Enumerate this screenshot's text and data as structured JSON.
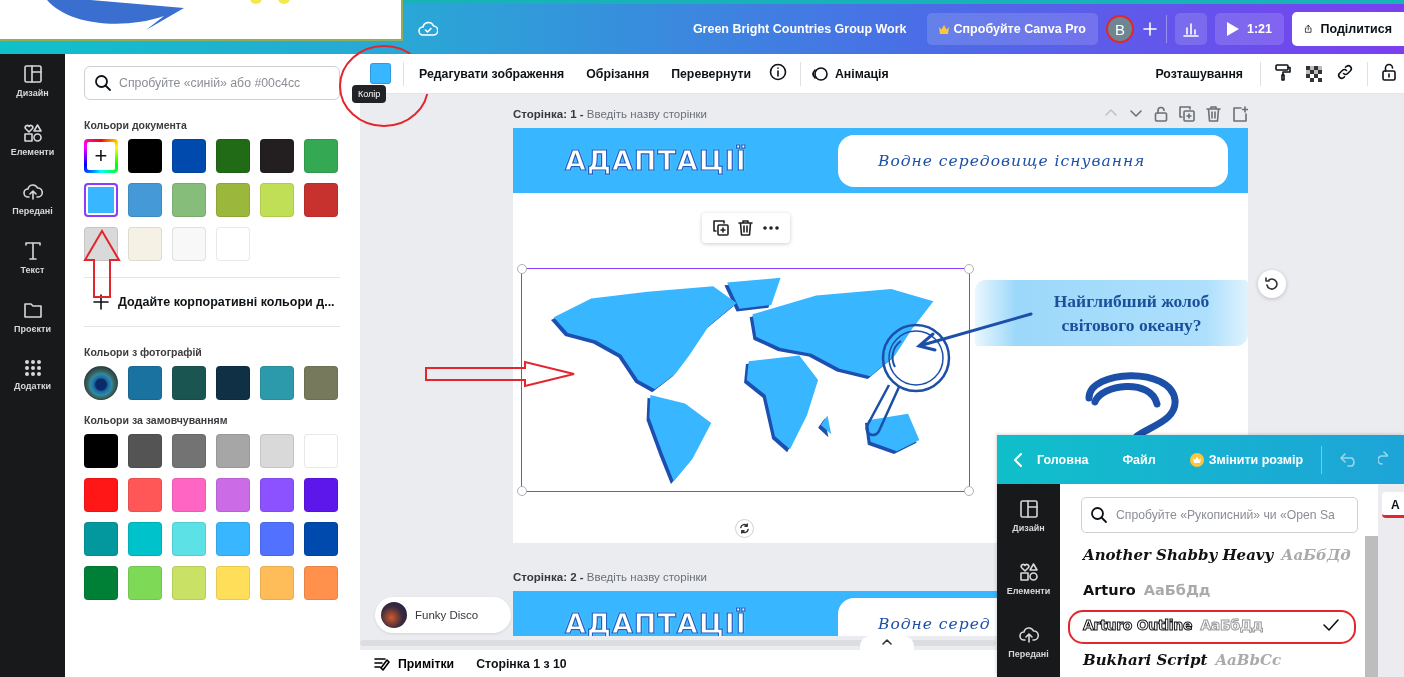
{
  "top_bar": {
    "title": "Green Bright Countries Group Work",
    "pro_button": "Спробуйте Canva Pro",
    "avatar": "B",
    "present_button": "1:21",
    "share_button": "Поділитися"
  },
  "side_rail": {
    "items": [
      {
        "kind": "layout",
        "label": "Дизайн"
      },
      {
        "kind": "shapes",
        "label": "Елементи"
      },
      {
        "kind": "upload",
        "label": "Передані"
      },
      {
        "kind": "text",
        "label": "Текст"
      },
      {
        "kind": "folder",
        "label": "Проєкти"
      },
      {
        "kind": "apps",
        "label": "Додатки"
      }
    ]
  },
  "color_panel": {
    "search": {
      "placeholder": "Спробуйте «синій» або #00c4cc"
    },
    "document_heading": "Кольори документа",
    "document_colors": [
      {
        "kind": "add",
        "label": "+",
        "selected": false
      },
      {
        "kind": "swatch",
        "color": "#000000",
        "selected": false
      },
      {
        "kind": "swatch",
        "color": "#004aad",
        "selected": false
      },
      {
        "kind": "swatch",
        "color": "#216b16",
        "selected": false
      },
      {
        "kind": "swatch",
        "color": "#231f20",
        "selected": false
      },
      {
        "kind": "swatch",
        "color": "#34a853",
        "selected": false
      },
      {
        "kind": "swatch",
        "color": "#38b6ff",
        "selected": true
      },
      {
        "kind": "swatch",
        "color": "#4599d6",
        "selected": false
      },
      {
        "kind": "swatch",
        "color": "#87bd7a",
        "selected": false
      },
      {
        "kind": "swatch",
        "color": "#9cb83c",
        "selected": false
      },
      {
        "kind": "swatch",
        "color": "#c1df56",
        "selected": false
      },
      {
        "kind": "swatch",
        "color": "#c7312e",
        "selected": false
      },
      {
        "kind": "swatch",
        "color": "#d9d9d9",
        "selected": false
      },
      {
        "kind": "swatch",
        "color": "#f5f1e4",
        "selected": false
      },
      {
        "kind": "swatch",
        "color": "#f8f8f8",
        "selected": false
      },
      {
        "kind": "swatch",
        "color": "#ffffff",
        "selected": false
      }
    ],
    "add_brand": "Додайте корпоративні кольори д...",
    "photo_heading": "Кольори з фотографій",
    "photo_colors": [
      {
        "kind": "photo",
        "selected": false
      },
      {
        "kind": "swatch",
        "color": "#1a72a0",
        "selected": false
      },
      {
        "kind": "swatch",
        "color": "#1b5552",
        "selected": false
      },
      {
        "kind": "swatch",
        "color": "#0f3045",
        "selected": false
      },
      {
        "kind": "swatch",
        "color": "#2c9aaa",
        "selected": false
      },
      {
        "kind": "swatch",
        "color": "#76795c",
        "selected": false
      }
    ],
    "default_heading": "Кольори за замовчуванням",
    "default_colors": [
      {
        "kind": "swatch",
        "color": "#000000",
        "selected": false
      },
      {
        "kind": "swatch",
        "color": "#545454",
        "selected": false
      },
      {
        "kind": "swatch",
        "color": "#737373",
        "selected": false
      },
      {
        "kind": "swatch",
        "color": "#a6a6a6",
        "selected": false
      },
      {
        "kind": "swatch",
        "color": "#d9d9d9",
        "selected": false
      },
      {
        "kind": "swatch",
        "color": "#ffffff",
        "selected": false
      },
      {
        "kind": "swatch",
        "color": "#ff1616",
        "selected": false
      },
      {
        "kind": "swatch",
        "color": "#ff5757",
        "selected": false
      },
      {
        "kind": "swatch",
        "color": "#ff66c4",
        "selected": false
      },
      {
        "kind": "swatch",
        "color": "#cb6ce6",
        "selected": false
      },
      {
        "kind": "swatch",
        "color": "#8c52ff",
        "selected": false
      },
      {
        "kind": "swatch",
        "color": "#5e17eb",
        "selected": false
      },
      {
        "kind": "swatch",
        "color": "#03989e",
        "selected": false
      },
      {
        "kind": "swatch",
        "color": "#00c2cb",
        "selected": false
      },
      {
        "kind": "swatch",
        "color": "#5ce1e6",
        "selected": false
      },
      {
        "kind": "swatch",
        "color": "#38b6ff",
        "selected": false
      },
      {
        "kind": "swatch",
        "color": "#5271ff",
        "selected": false
      },
      {
        "kind": "swatch",
        "color": "#004aad",
        "selected": false
      },
      {
        "kind": "swatch",
        "color": "#008037",
        "selected": false
      },
      {
        "kind": "swatch",
        "color": "#7ed957",
        "selected": false
      },
      {
        "kind": "swatch",
        "color": "#c9e265",
        "selected": false
      },
      {
        "kind": "swatch",
        "color": "#ffde59",
        "selected": false
      },
      {
        "kind": "swatch",
        "color": "#ffbd59",
        "selected": false
      },
      {
        "kind": "swatch",
        "color": "#ff914d",
        "selected": false
      }
    ]
  },
  "toolbar": {
    "color_button": {
      "color": "#38b6ff"
    },
    "tooltip": "Колір",
    "items": [
      "Редагувати зображення",
      "Обрізання",
      "Перевернути"
    ],
    "animation": "Анімація",
    "position": "Розташування"
  },
  "canvas": {
    "pages": [
      {
        "label": "**Сторінка: 1 -** Введіть назву сторінки",
        "heading": "АДАПТАЦІЇ",
        "subtitle": "Водне середовище існування",
        "question": "Найглибший жолоб світового океану?"
      },
      {
        "label": "**Сторінка: 2 -** Введіть назву сторінки",
        "heading": "АДАПТАЦІЇ",
        "subtitle": "Водне серед"
      }
    ],
    "music_chip": "Funky Disco"
  },
  "bottom_bar": {
    "notes": "Примітки",
    "page_counter": "Сторінка 1 з 10"
  },
  "inset": {
    "nav": {
      "back": "Головна",
      "file": "Файл",
      "resize": "Змінити розмір"
    },
    "side_rail": [
      {
        "kind": "layout",
        "label": "Дизайн"
      },
      {
        "kind": "shapes",
        "label": "Елементи"
      },
      {
        "kind": "upload",
        "label": "Передані"
      }
    ],
    "font_search": {
      "placeholder": "Спробуйте «Рукописний» чи «Open Sa"
    },
    "fonts": [
      {
        "kind": "script",
        "name": "Another Shabby Heavy",
        "sample": "АаБбДд",
        "selected": false
      },
      {
        "kind": "bold",
        "name": "Arturo",
        "sample": "АаБбДд",
        "selected": false
      },
      {
        "kind": "outline",
        "name": "Arturo Outline",
        "sample": "АаБбДд",
        "selected": true
      },
      {
        "kind": "script",
        "name": "Bukhari Script",
        "sample": "AaBbCc",
        "selected": false
      }
    ],
    "tab_label": "A"
  }
}
